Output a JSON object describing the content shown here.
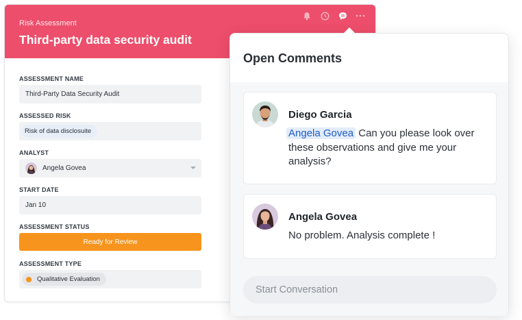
{
  "form": {
    "header_label": "Risk Assessment",
    "header_title": "Third-party data security audit",
    "colors": {
      "header": "#ec4e6b",
      "status": "#f7941d"
    },
    "header_icons": [
      "bell-icon",
      "clock-icon",
      "comment-icon",
      "more-icon"
    ],
    "fields": {
      "assessment_name": {
        "label": "ASSESSMENT NAME",
        "value": "Third-Party Data Security Audit"
      },
      "assessed_risk": {
        "label": "ASSESSED RISK",
        "value": "Risk of data disclosuite"
      },
      "analyst": {
        "label": "ANALYST",
        "value": "Angela Govea"
      },
      "start_date": {
        "label": "START DATE",
        "value": "Jan 10"
      },
      "assessment_status": {
        "label": "ASSESSMENT STATUS",
        "value": "Ready for Review"
      },
      "assessment_type": {
        "label": "ASSESSMENT TYPE",
        "value": "Qualitative Evaluation"
      }
    }
  },
  "comments_panel": {
    "title": "Open Comments",
    "comments": [
      {
        "author": "Diego Garcia",
        "mention": "Angela Govea",
        "text": "Can you please look over these observations and give me your analysis?"
      },
      {
        "author": "Angela Govea",
        "text": "No problem. Analysis complete !"
      }
    ],
    "input_placeholder": "Start Conversation"
  }
}
